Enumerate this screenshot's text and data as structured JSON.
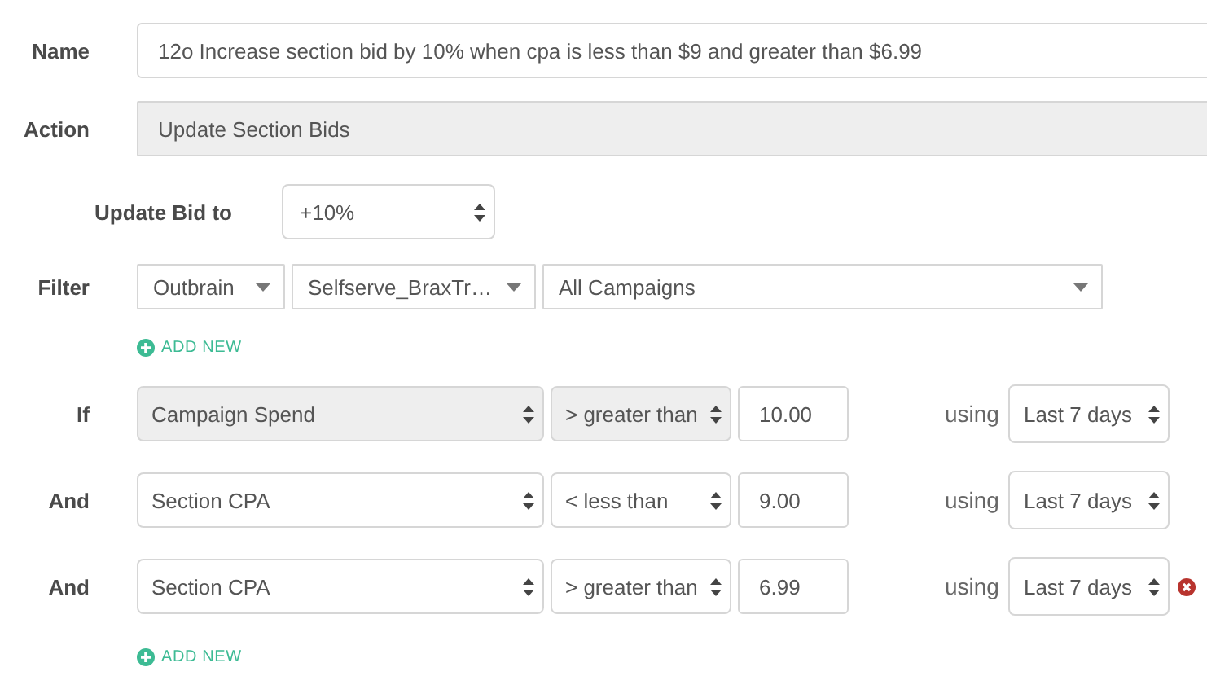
{
  "name": {
    "label": "Name",
    "value": "12o Increase section bid by 10% when cpa is less than $9 and greater than $6.99"
  },
  "action": {
    "label": "Action",
    "value": "Update Section Bids",
    "disabled": true
  },
  "update_bid": {
    "label": "Update Bid to",
    "value": "+10%"
  },
  "filter": {
    "label": "Filter",
    "selects": [
      {
        "value": "Outbrain"
      },
      {
        "value": "Selfserve_BraxTr…"
      },
      {
        "value": "All Campaigns"
      }
    ],
    "add_new": "ADD NEW"
  },
  "conditions": [
    {
      "label": "If",
      "metric": "Campaign Spend",
      "operator": "> greater than",
      "value": "10.00",
      "using": "using",
      "period": "Last 7 days",
      "disabled": true,
      "removable": false
    },
    {
      "label": "And",
      "metric": "Section CPA",
      "operator": "< less than",
      "value": "9.00",
      "using": "using",
      "period": "Last 7 days",
      "disabled": false,
      "removable": false
    },
    {
      "label": "And",
      "metric": "Section CPA",
      "operator": "> greater than",
      "value": "6.99",
      "using": "using",
      "period": "Last 7 days",
      "disabled": false,
      "removable": true
    }
  ],
  "conditions_add_new": "ADD NEW"
}
